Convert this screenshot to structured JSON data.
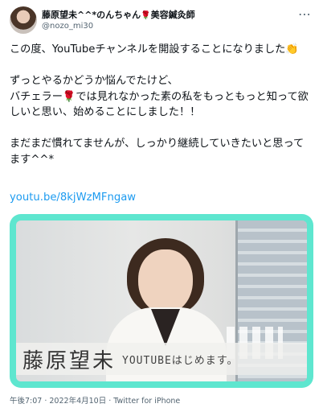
{
  "author": {
    "name": "藤原望未^^*のんちゃん",
    "rose": "🌹",
    "title": "美容鍼灸師",
    "handle": "@nozo_mi30"
  },
  "tweet": {
    "text": "この度、YouTubeチャンネルを開設することになりました👏\n\nずっとやるかどうか悩んでたけど、\nバチェラー🌹では見れなかった素の私をもっともっと知って欲しいと思い、始めることにしました！！\n\nまだまだ慣れてませんが、しっかり継続していきたいと思ってます^^*",
    "link": "youtu.be/8kjWzMFngaw"
  },
  "media": {
    "caption_name": "藤原望未",
    "caption_sub": "YOUTUBEはじめます。",
    "frame_color": "#5ee6cf"
  },
  "meta": {
    "timestamp": "午後7:07 · 2022年4月10日 · Twitter for iPhone"
  },
  "icons": {
    "more": "more-icon"
  }
}
